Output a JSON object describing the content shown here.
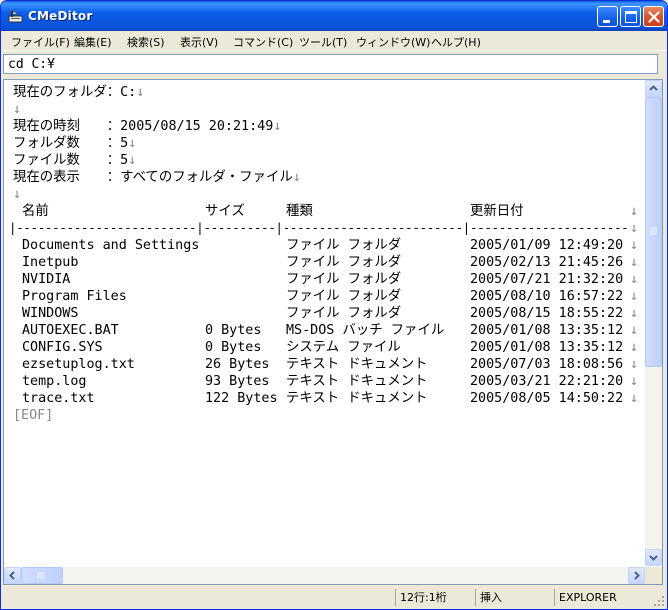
{
  "window": {
    "title": "CMeDitor"
  },
  "menu": [
    {
      "label": "ファイル(F)"
    },
    {
      "label": "編集(E)"
    },
    {
      "label": "検索(S)"
    },
    {
      "label": "表示(V)"
    },
    {
      "label": "コマンド(C)"
    },
    {
      "label": "ツール(T)"
    },
    {
      "label": "ウィンドウ(W)"
    },
    {
      "label": "ヘルプ(H)"
    }
  ],
  "command": {
    "value": "cd C:¥"
  },
  "editor": {
    "eol": "↓",
    "header_lines": [
      "現在のフォルダ：C:",
      "",
      "現在の時刻　　：2005/08/15 20:21:49",
      "フォルダ数　　：5",
      "ファイル数　　：5",
      "現在の表示　　：すべてのフォルダ・ファイル",
      ""
    ],
    "columns": [
      "名前",
      "サイズ",
      "種類",
      "更新日付"
    ],
    "separator": "|-------------------------|----------|-------------------------|-----------------------",
    "rows": [
      {
        "name": "Documents and Settings",
        "size": "",
        "type": "ファイル フォルダ",
        "date": "2005/01/09 12:49:20"
      },
      {
        "name": "Inetpub",
        "size": "",
        "type": "ファイル フォルダ",
        "date": "2005/02/13 21:45:26"
      },
      {
        "name": "NVIDIA",
        "size": "",
        "type": "ファイル フォルダ",
        "date": "2005/07/21 21:32:20"
      },
      {
        "name": "Program Files",
        "size": "",
        "type": "ファイル フォルダ",
        "date": "2005/08/10 16:57:22"
      },
      {
        "name": "WINDOWS",
        "size": "",
        "type": "ファイル フォルダ",
        "date": "2005/08/15 18:55:22"
      },
      {
        "name": "AUTOEXEC.BAT",
        "size": "0 Bytes",
        "type": "MS-DOS バッチ ファイル",
        "date": "2005/01/08 13:35:12"
      },
      {
        "name": "CONFIG.SYS",
        "size": "0 Bytes",
        "type": "システム ファイル",
        "date": "2005/01/08 13:35:12"
      },
      {
        "name": "ezsetuplog.txt",
        "size": "26 Bytes",
        "type": "テキスト ドキュメント",
        "date": "2005/07/03 18:08:56"
      },
      {
        "name": "temp.log",
        "size": "93 Bytes",
        "type": "テキスト ドキュメント",
        "date": "2005/03/21 22:21:20"
      },
      {
        "name": "trace.txt",
        "size": "122 Bytes",
        "type": "テキスト ドキュメント",
        "date": "2005/08/05 14:50:22"
      }
    ],
    "eof": "[EOF]"
  },
  "status": {
    "position": "12行:1桁",
    "mode": "挿入",
    "app": "EXPLORER"
  }
}
